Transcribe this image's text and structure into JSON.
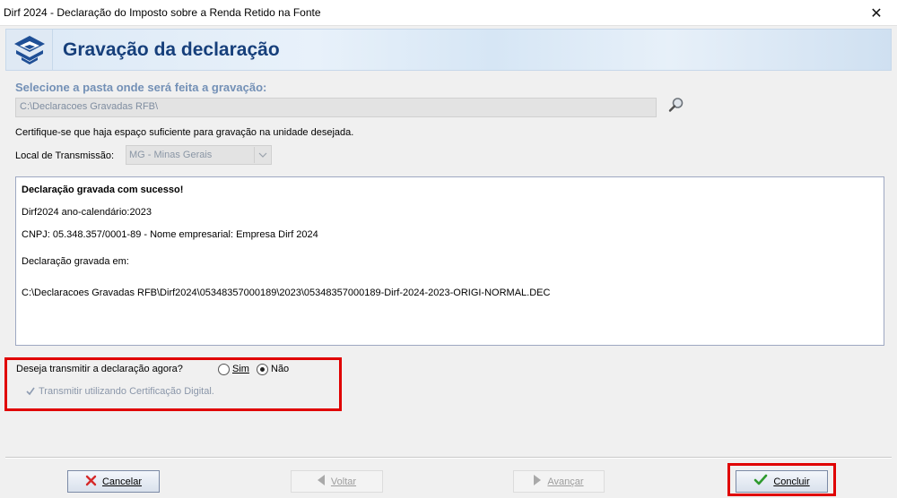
{
  "window": {
    "title": "Dirf 2024 - Declaração do Imposto sobre a Renda Retido na Fonte",
    "close_label": "✕"
  },
  "banner": {
    "heading": "Gravação da declaração",
    "logo_icon": "receita-federal-logo-icon"
  },
  "folder": {
    "label": "Selecione a pasta onde será feita a gravação:",
    "path_value": "C:\\Declaracoes Gravadas RFB\\",
    "browse_icon": "magnifier-icon"
  },
  "notice": "Certifique-se que haja espaço suficiente para gravação na unidade desejada.",
  "local": {
    "label": "Local de Transmissão:",
    "selected": "MG - Minas Gerais"
  },
  "message": {
    "success": "Declaração gravada com sucesso!",
    "year_line": "Dirf2024 ano-calendário:2023",
    "cnpj_line": "CNPJ: 05.348.357/0001-89 - Nome empresarial: Empresa Dirf 2024",
    "saved_in": "Declaração gravada em:",
    "file_path": "C:\\Declaracoes Gravadas RFB\\Dirf2024\\05348357000189\\2023\\05348357000189-Dirf-2024-2023-ORIGI-NORMAL.DEC"
  },
  "transmit": {
    "question": "Deseja transmitir a declaração agora?",
    "option_yes": "Sim",
    "option_no": "Não",
    "selected": "Não",
    "digital_cert_label": "Transmitir utilizando Certificação Digital.",
    "digital_cert_checked": true
  },
  "buttons": {
    "cancel": "Cancelar",
    "back": "Voltar",
    "next": "Avançar",
    "finish": "Concluir"
  },
  "colors": {
    "heading": "#163f7b",
    "highlight": "#e00000",
    "folder_label": "#7390b6"
  }
}
